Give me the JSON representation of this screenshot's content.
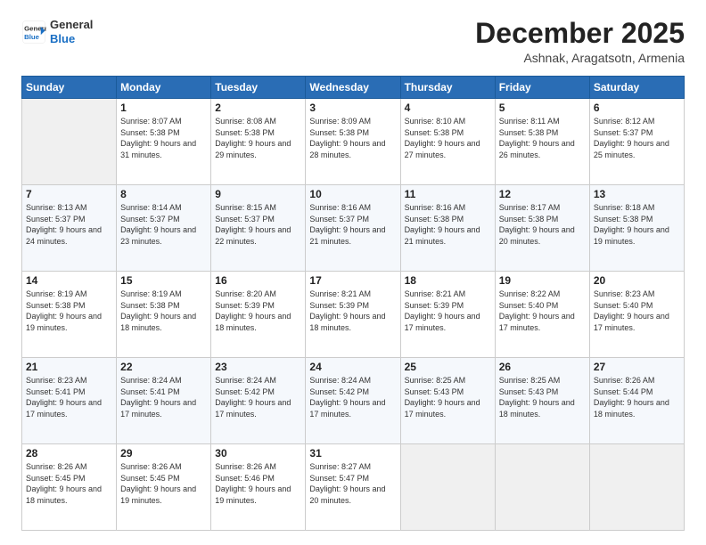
{
  "logo": {
    "line1": "General",
    "line2": "Blue"
  },
  "title": "December 2025",
  "subtitle": "Ashnak, Aragatsotn, Armenia",
  "days_of_week": [
    "Sunday",
    "Monday",
    "Tuesday",
    "Wednesday",
    "Thursday",
    "Friday",
    "Saturday"
  ],
  "weeks": [
    [
      {
        "day": "",
        "empty": true
      },
      {
        "day": "1",
        "sunrise": "8:07 AM",
        "sunset": "5:38 PM",
        "daylight": "9 hours and 31 minutes."
      },
      {
        "day": "2",
        "sunrise": "8:08 AM",
        "sunset": "5:38 PM",
        "daylight": "9 hours and 29 minutes."
      },
      {
        "day": "3",
        "sunrise": "8:09 AM",
        "sunset": "5:38 PM",
        "daylight": "9 hours and 28 minutes."
      },
      {
        "day": "4",
        "sunrise": "8:10 AM",
        "sunset": "5:38 PM",
        "daylight": "9 hours and 27 minutes."
      },
      {
        "day": "5",
        "sunrise": "8:11 AM",
        "sunset": "5:38 PM",
        "daylight": "9 hours and 26 minutes."
      },
      {
        "day": "6",
        "sunrise": "8:12 AM",
        "sunset": "5:37 PM",
        "daylight": "9 hours and 25 minutes."
      }
    ],
    [
      {
        "day": "7",
        "sunrise": "8:13 AM",
        "sunset": "5:37 PM",
        "daylight": "9 hours and 24 minutes."
      },
      {
        "day": "8",
        "sunrise": "8:14 AM",
        "sunset": "5:37 PM",
        "daylight": "9 hours and 23 minutes."
      },
      {
        "day": "9",
        "sunrise": "8:15 AM",
        "sunset": "5:37 PM",
        "daylight": "9 hours and 22 minutes."
      },
      {
        "day": "10",
        "sunrise": "8:16 AM",
        "sunset": "5:37 PM",
        "daylight": "9 hours and 21 minutes."
      },
      {
        "day": "11",
        "sunrise": "8:16 AM",
        "sunset": "5:38 PM",
        "daylight": "9 hours and 21 minutes."
      },
      {
        "day": "12",
        "sunrise": "8:17 AM",
        "sunset": "5:38 PM",
        "daylight": "9 hours and 20 minutes."
      },
      {
        "day": "13",
        "sunrise": "8:18 AM",
        "sunset": "5:38 PM",
        "daylight": "9 hours and 19 minutes."
      }
    ],
    [
      {
        "day": "14",
        "sunrise": "8:19 AM",
        "sunset": "5:38 PM",
        "daylight": "9 hours and 19 minutes."
      },
      {
        "day": "15",
        "sunrise": "8:19 AM",
        "sunset": "5:38 PM",
        "daylight": "9 hours and 18 minutes."
      },
      {
        "day": "16",
        "sunrise": "8:20 AM",
        "sunset": "5:39 PM",
        "daylight": "9 hours and 18 minutes."
      },
      {
        "day": "17",
        "sunrise": "8:21 AM",
        "sunset": "5:39 PM",
        "daylight": "9 hours and 18 minutes."
      },
      {
        "day": "18",
        "sunrise": "8:21 AM",
        "sunset": "5:39 PM",
        "daylight": "9 hours and 17 minutes."
      },
      {
        "day": "19",
        "sunrise": "8:22 AM",
        "sunset": "5:40 PM",
        "daylight": "9 hours and 17 minutes."
      },
      {
        "day": "20",
        "sunrise": "8:23 AM",
        "sunset": "5:40 PM",
        "daylight": "9 hours and 17 minutes."
      }
    ],
    [
      {
        "day": "21",
        "sunrise": "8:23 AM",
        "sunset": "5:41 PM",
        "daylight": "9 hours and 17 minutes."
      },
      {
        "day": "22",
        "sunrise": "8:24 AM",
        "sunset": "5:41 PM",
        "daylight": "9 hours and 17 minutes."
      },
      {
        "day": "23",
        "sunrise": "8:24 AM",
        "sunset": "5:42 PM",
        "daylight": "9 hours and 17 minutes."
      },
      {
        "day": "24",
        "sunrise": "8:24 AM",
        "sunset": "5:42 PM",
        "daylight": "9 hours and 17 minutes."
      },
      {
        "day": "25",
        "sunrise": "8:25 AM",
        "sunset": "5:43 PM",
        "daylight": "9 hours and 17 minutes."
      },
      {
        "day": "26",
        "sunrise": "8:25 AM",
        "sunset": "5:43 PM",
        "daylight": "9 hours and 18 minutes."
      },
      {
        "day": "27",
        "sunrise": "8:26 AM",
        "sunset": "5:44 PM",
        "daylight": "9 hours and 18 minutes."
      }
    ],
    [
      {
        "day": "28",
        "sunrise": "8:26 AM",
        "sunset": "5:45 PM",
        "daylight": "9 hours and 18 minutes."
      },
      {
        "day": "29",
        "sunrise": "8:26 AM",
        "sunset": "5:45 PM",
        "daylight": "9 hours and 19 minutes."
      },
      {
        "day": "30",
        "sunrise": "8:26 AM",
        "sunset": "5:46 PM",
        "daylight": "9 hours and 19 minutes."
      },
      {
        "day": "31",
        "sunrise": "8:27 AM",
        "sunset": "5:47 PM",
        "daylight": "9 hours and 20 minutes."
      },
      {
        "day": "",
        "empty": true
      },
      {
        "day": "",
        "empty": true
      },
      {
        "day": "",
        "empty": true
      }
    ]
  ]
}
